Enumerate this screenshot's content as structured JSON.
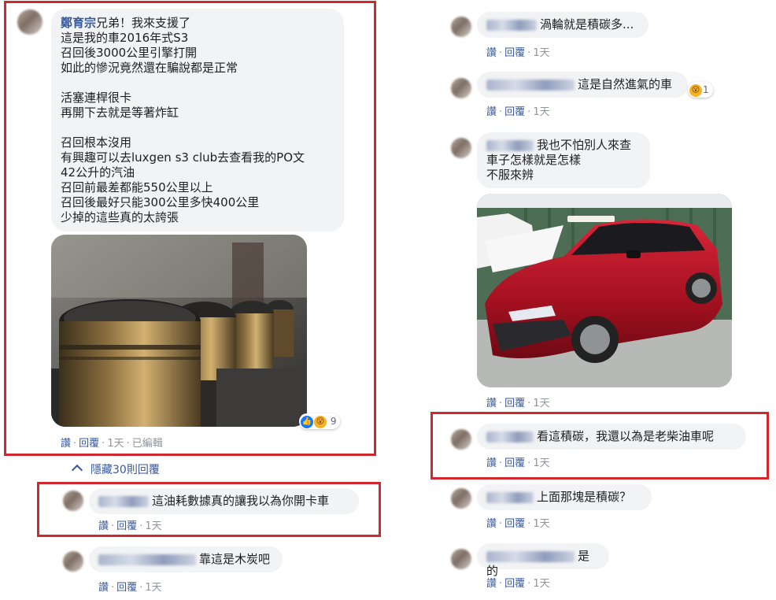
{
  "left": {
    "main_comment": {
      "author": "鄭育宗",
      "text": "兄弟！我來支援了\n這是我的車2016年式S3\n召回後3000公里引擎打開\n如此的慘況竟然還在騙說都是正常\n\n活塞連桿很卡\n再開下去就是等著炸缸\n\n召回根本沒用\n有興趣可以去luxgen s3 club去查看我的PO文\n42公升的汽油\n召回前最差都能550公里以上\n召回後最好只能300公里多快400公里\n少掉的這些真的太誇張",
      "reaction_count": "9",
      "like": "讚",
      "reply": "回覆",
      "time": "1天",
      "edited": "已編輯"
    },
    "hide_replies": "隱藏30則回覆",
    "reply1": {
      "text": "這油耗數據真的讓我以為你開卡車",
      "like": "讚",
      "reply": "回覆",
      "time": "1天"
    },
    "reply2": {
      "text": "靠這是木炭吧",
      "like": "讚",
      "reply": "回覆",
      "time": "1天"
    }
  },
  "right": {
    "c1": {
      "text": "渦輪就是積碳多...",
      "like": "讚",
      "reply": "回覆",
      "time": "1天"
    },
    "c2": {
      "text": "這是自然進氣的車",
      "reaction_count": "1",
      "like": "讚",
      "reply": "回覆",
      "time": "1天"
    },
    "c3": {
      "text": "我也不怕別人來查\n車子怎樣就是怎樣\n不服來辨",
      "like": "讚",
      "reply": "回覆",
      "time": "1天"
    },
    "c4": {
      "text": "看這積碳，我還以為是老柴油車呢",
      "like": "讚",
      "reply": "回覆",
      "time": "1天"
    },
    "c5": {
      "text": "上面那塊是積碳？",
      "like": "讚",
      "reply": "回覆",
      "time": "1天"
    },
    "c6": {
      "text": "是的",
      "like": "讚",
      "reply": "回覆",
      "time": "1天"
    }
  },
  "colors": {
    "link": "#385898",
    "bubble": "#f2f3f5",
    "highlight": "#d0282e",
    "meta": "#90949c"
  }
}
